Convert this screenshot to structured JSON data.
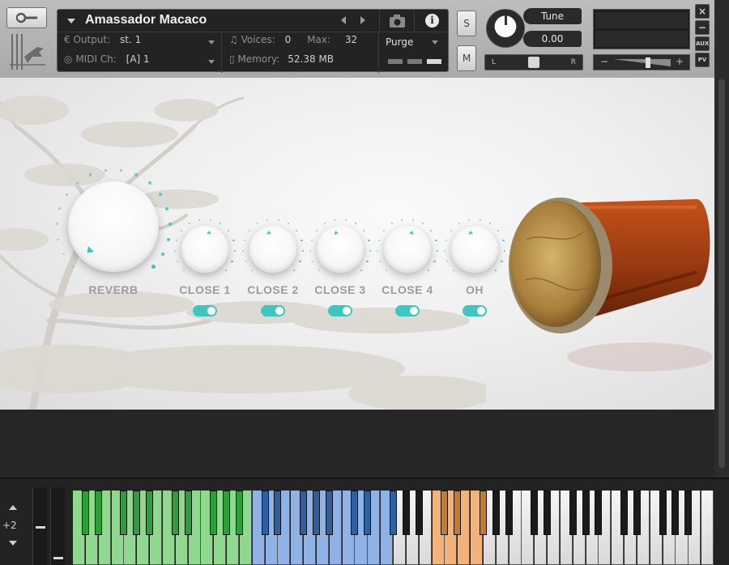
{
  "instrument": {
    "name": "Amassador Macaco",
    "output_label": "Output:",
    "output_value": "st. 1",
    "midi_label": "MIDI Ch:",
    "midi_value": "[A]  1",
    "voices_label": "Voices:",
    "voices_value": "0",
    "max_label": "Max:",
    "max_value": "32",
    "memory_label": "Memory:",
    "memory_value": "52.38 MB",
    "purge_label": "Purge",
    "info_label": "i"
  },
  "controls": {
    "solo_label": "S",
    "mute_label": "M",
    "tune_label": "Tune",
    "tune_value": "0.00",
    "pan_left": "L",
    "pan_right": "R",
    "vol_minus": "−",
    "vol_plus": "+",
    "close_label": "×",
    "minimize_label": "−",
    "aux_label": "AUX",
    "pv_label": "PV"
  },
  "knobs": [
    {
      "name": "reverb",
      "label": "REVERB",
      "value": 0.0
    },
    {
      "name": "close-1",
      "label": "CLOSE 1",
      "value": 0.55,
      "enabled": true
    },
    {
      "name": "close-2",
      "label": "CLOSE 2",
      "value": 0.45,
      "enabled": true
    },
    {
      "name": "close-3",
      "label": "CLOSE 3",
      "value": 0.45,
      "enabled": true
    },
    {
      "name": "close-4",
      "label": "CLOSE 4",
      "value": 0.55,
      "enabled": true
    },
    {
      "name": "oh",
      "label": "OH",
      "value": 0.45,
      "enabled": true
    }
  ],
  "keyboard": {
    "octave_value": "+2",
    "zones": [
      {
        "from_white": 0,
        "to_white": 7,
        "color": "#8fd98f",
        "black_color": "#2e9e3a"
      },
      {
        "from_white": 7,
        "to_white": 14,
        "color": "#8fd98f",
        "black_color": "#2e9e3a"
      },
      {
        "from_white": 14,
        "to_white": 25,
        "color": "#8fb3e6",
        "black_color": "#2f5f9e"
      },
      {
        "from_white": 28,
        "to_white": 32,
        "color": "#f2b27a",
        "black_color": "#c57a2e"
      }
    ],
    "white_key_count": 50
  },
  "colors": {
    "accent": "#3ec7c2"
  }
}
